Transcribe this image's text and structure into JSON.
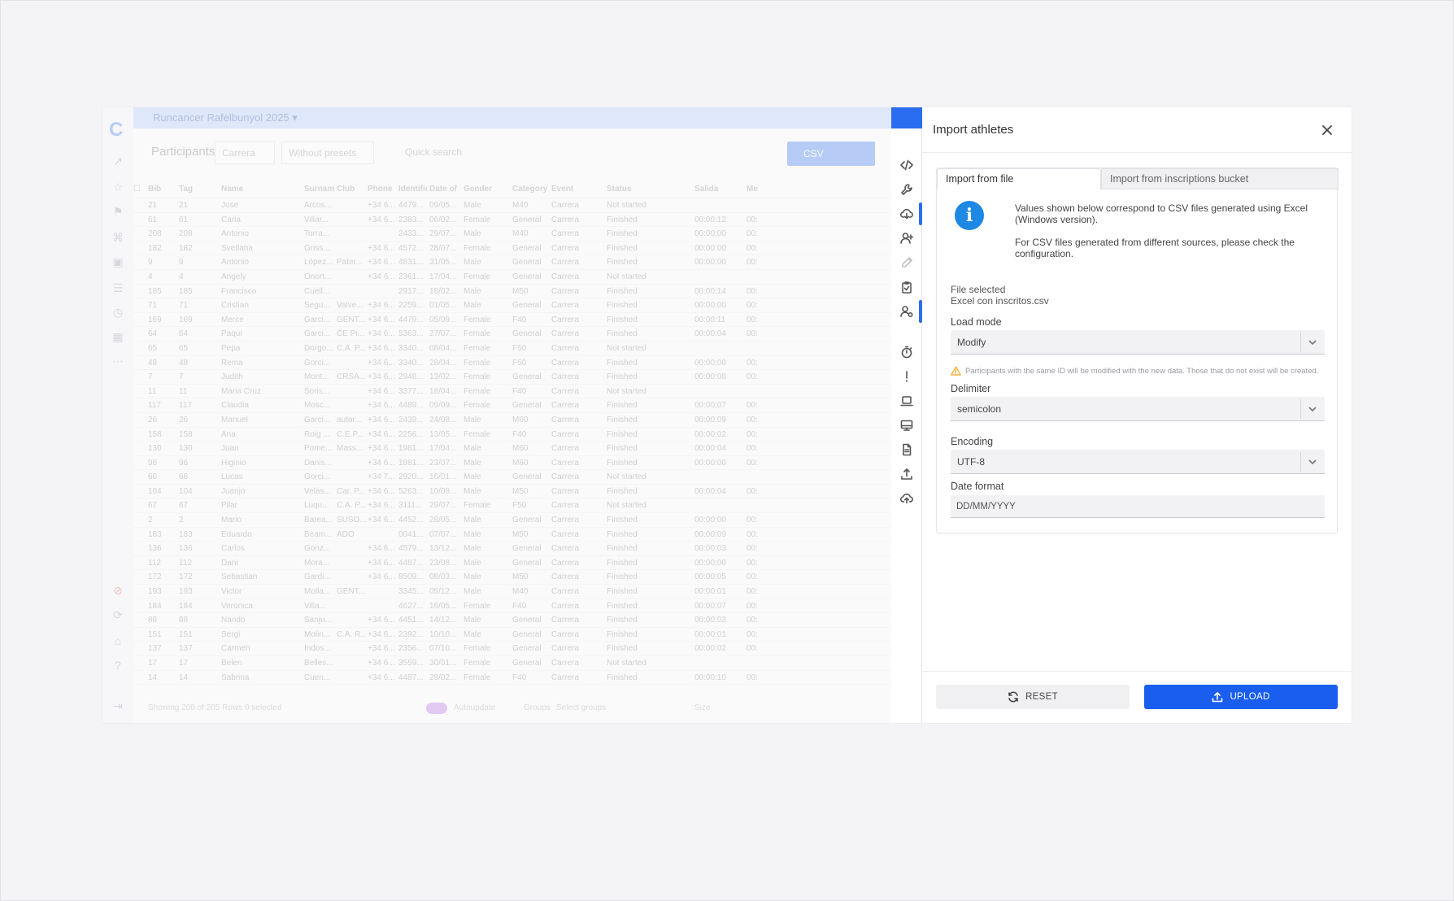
{
  "background_app": {
    "event_name": "Runcancer Rafelbunyol 2025",
    "toolbar": {
      "title": "Participants",
      "event_select": "Carrera",
      "preset_select": "Without presets",
      "search_placeholder": "Quick search",
      "csv_label": "CSV"
    },
    "table": {
      "columns": [
        "Bib",
        "Tag",
        "Name",
        "Surname",
        "Club",
        "Phone",
        "Identific",
        "Date of",
        "Gender",
        "Category",
        "Event",
        "Status",
        "Salida",
        "Me"
      ],
      "rows": [
        [
          "21",
          "21",
          "Jose",
          "Arcos...",
          "",
          "+34 6...",
          "4479...",
          "09/05...",
          "Male",
          "M40",
          "Carrera",
          "Not started",
          "",
          ""
        ],
        [
          "61",
          "61",
          "Carla",
          "Villar...",
          "",
          "+34 6...",
          "2383...",
          "06/02...",
          "Female",
          "General",
          "Carrera",
          "Finished",
          "00:00:12",
          "00:"
        ],
        [
          "208",
          "208",
          "Antonio",
          "Torra...",
          "",
          "",
          "2433...",
          "29/07...",
          "Male",
          "M40",
          "Carrera",
          "Finished",
          "00:00:00",
          "00:"
        ],
        [
          "182",
          "182",
          "Svetlana",
          "Griss...",
          "",
          "+34 6...",
          "4572...",
          "28/07...",
          "Female",
          "General",
          "Carrera",
          "Finished",
          "00:00:00",
          "00:"
        ],
        [
          "9",
          "9",
          "Antonio",
          "López...",
          "Pater...",
          "+34 6...",
          "4831...",
          "31/05...",
          "Male",
          "General",
          "Carrera",
          "Finished",
          "00:00:00",
          "00:"
        ],
        [
          "4",
          "4",
          "Angely",
          "Onort...",
          "",
          "+34 6...",
          "2361...",
          "17/04...",
          "Female",
          "General",
          "Carrera",
          "Not started",
          "",
          ""
        ],
        [
          "185",
          "185",
          "Francisco",
          "Cuell...",
          "",
          "",
          "2917...",
          "18/02...",
          "Male",
          "M50",
          "Carrera",
          "Finished",
          "00:00:14",
          "00:"
        ],
        [
          "71",
          "71",
          "Cristian",
          "Segu...",
          "Valve...",
          "+34 6...",
          "2259...",
          "01/05...",
          "Male",
          "General",
          "Carrera",
          "Finished",
          "00:00:00",
          "00:"
        ],
        [
          "169",
          "169",
          "Merce",
          "Garci...",
          "GENT...",
          "+34 6...",
          "4479...",
          "05/09...",
          "Female",
          "F40",
          "Carrera",
          "Finished",
          "00:00:11",
          "00:"
        ],
        [
          "64",
          "64",
          "Paqui",
          "Garci...",
          "CE Pi...",
          "+34 6...",
          "5363...",
          "27/07...",
          "Female",
          "General",
          "Carrera",
          "Finished",
          "00:00:04",
          "00:"
        ],
        [
          "65",
          "65",
          "Pepa",
          "Dorgo...",
          "C.A. P...",
          "+34 6...",
          "3340...",
          "08/04...",
          "Female",
          "F50",
          "Carrera",
          "Not started",
          "",
          ""
        ],
        [
          "48",
          "48",
          "Rema",
          "Gorci...",
          "",
          "+34 6...",
          "3340...",
          "28/04...",
          "Female",
          "F50",
          "Carrera",
          "Finished",
          "00:00:00",
          "00:"
        ],
        [
          "7",
          "7",
          "Judith",
          "Mont...",
          "CRSA...",
          "+34 6...",
          "2948...",
          "13/02...",
          "Female",
          "General",
          "Carrera",
          "Finished",
          "00:00:08",
          "00:"
        ],
        [
          "11",
          "11",
          "Maria Cruz",
          "Soris...",
          "",
          "+34 6...",
          "3377...",
          "18/04...",
          "Female",
          "F40",
          "Carrera",
          "Not started",
          "",
          ""
        ],
        [
          "117",
          "117",
          "Claudia",
          "Mosc...",
          "",
          "+34 6...",
          "4489...",
          "09/09...",
          "Female",
          "General",
          "Carrera",
          "Finished",
          "00:00:07",
          "00:"
        ],
        [
          "26",
          "26",
          "Manuel",
          "Garci...",
          "autor...",
          "+34 6...",
          "2439...",
          "24/08...",
          "Male",
          "M60",
          "Carrera",
          "Finished",
          "00:00:09",
          "00:"
        ],
        [
          "158",
          "158",
          "Ana",
          "Roig ...",
          "C.E.P...",
          "+34 6...",
          "2256...",
          "13/05...",
          "Female",
          "F40",
          "Carrera",
          "Finished",
          "00:00:02",
          "00:"
        ],
        [
          "130",
          "130",
          "Juan",
          "Pome...",
          "Mass...",
          "+34 6...",
          "1981...",
          "17/04...",
          "Male",
          "M60",
          "Carrera",
          "Finished",
          "00:00:04",
          "00:"
        ],
        [
          "96",
          "96",
          "Higinio",
          "Danis...",
          "",
          "+34 6...",
          "1881...",
          "23/07...",
          "Male",
          "M60",
          "Carrera",
          "Finished",
          "00:00:00",
          "00:"
        ],
        [
          "66",
          "66",
          "Lucas",
          "Gorci...",
          "",
          "+34 7...",
          "2920...",
          "16/01...",
          "Male",
          "General",
          "Carrera",
          "Not started",
          "",
          ""
        ],
        [
          "104",
          "104",
          "Juanjo",
          "Velas...",
          "Car. P...",
          "+34 6...",
          "5263...",
          "10/08...",
          "Male",
          "M50",
          "Carrera",
          "Finished",
          "00:00:04",
          "00:"
        ],
        [
          "67",
          "67",
          "Pilar",
          "Luqu...",
          "C.A. P...",
          "+34 6...",
          "3111...",
          "29/07...",
          "Female",
          "F50",
          "Carrera",
          "Not started",
          "",
          ""
        ],
        [
          "2",
          "2",
          "Mario",
          "Barea...",
          "SUSO...",
          "+34 6...",
          "4452...",
          "28/05...",
          "Male",
          "General",
          "Carrera",
          "Finished",
          "00:00:00",
          "00:"
        ],
        [
          "183",
          "183",
          "Eduardo",
          "Beam...",
          "ADO",
          "",
          "0041...",
          "07/07...",
          "Male",
          "M50",
          "Carrera",
          "Finished",
          "00:00:09",
          "00:"
        ],
        [
          "136",
          "136",
          "Carlos",
          "Gonz...",
          "",
          "+34 6...",
          "4579...",
          "13/12...",
          "Male",
          "General",
          "Carrera",
          "Finished",
          "00:00:03",
          "00:"
        ],
        [
          "112",
          "112",
          "Dani",
          "Mora...",
          "",
          "+34 6...",
          "4487...",
          "23/08...",
          "Male",
          "General",
          "Carrera",
          "Finished",
          "00:00:00",
          "00:"
        ],
        [
          "172",
          "172",
          "Sebastian",
          "Gardi...",
          "",
          "+34 6...",
          "8509...",
          "08/03...",
          "Male",
          "M50",
          "Carrera",
          "Finished",
          "00:00:05",
          "00:"
        ],
        [
          "193",
          "193",
          "Victor",
          "Molla...",
          "GENT...",
          "",
          "3345...",
          "05/12...",
          "Male",
          "M40",
          "Carrera",
          "Finished",
          "00:00:01",
          "00:"
        ],
        [
          "184",
          "184",
          "Veronica",
          "Villa...",
          "",
          "",
          "4627...",
          "16/05...",
          "Female",
          "F40",
          "Carrera",
          "Finished",
          "00:00:07",
          "00:"
        ],
        [
          "88",
          "88",
          "Nando",
          "Sanju...",
          "",
          "+34 6...",
          "4451...",
          "14/12...",
          "Male",
          "General",
          "Carrera",
          "Finished",
          "00:00:03",
          "00:"
        ],
        [
          "151",
          "151",
          "Sergi",
          "Molin...",
          "C.A. R...",
          "+34 6...",
          "2392...",
          "10/10...",
          "Male",
          "General",
          "Carrera",
          "Finished",
          "00:00:01",
          "00:"
        ],
        [
          "137",
          "137",
          "Carmen",
          "Indos...",
          "",
          "+34 6...",
          "2356...",
          "07/10...",
          "Female",
          "General",
          "Carrera",
          "Finished",
          "00:00:02",
          "00:"
        ],
        [
          "17",
          "17",
          "Belen",
          "Belles...",
          "",
          "+34 6...",
          "3559...",
          "30/01...",
          "Female",
          "General",
          "Carrera",
          "Not started",
          "",
          ""
        ],
        [
          "14",
          "14",
          "Sabrina",
          "Cuen...",
          "",
          "+34 6...",
          "4487...",
          "28/02...",
          "Female",
          "F40",
          "Carrera",
          "Finished",
          "00:00:10",
          "00:"
        ]
      ]
    },
    "footer": {
      "showing_text": "Showing 200 of 205 Rows 0 selected",
      "autoupdate_label": "Autoupdate",
      "groups_label": "Groups",
      "groups_placeholder": "Select groups",
      "size_value": "Size"
    }
  },
  "drawer": {
    "title": "Import athletes",
    "tabs": [
      {
        "label": "Import from file",
        "active": true
      },
      {
        "label": "Import from inscriptions bucket",
        "active": false
      }
    ],
    "info": {
      "line1": "Values shown below correspond to CSV files generated using Excel (Windows version).",
      "line2": "For CSV files generated from different sources, please check the configuration."
    },
    "file": {
      "label": "File selected",
      "name": "Excel con inscritos.csv"
    },
    "load_mode": {
      "label": "Load mode",
      "value": "Modify",
      "warning": "Participants with the same ID will be modified with the new data. Those that do not exist will be created."
    },
    "delimiter": {
      "label": "Delimiter",
      "value": "semicolon"
    },
    "encoding": {
      "label": "Encoding",
      "value": "UTF-8"
    },
    "date_format": {
      "label": "Date format",
      "value": "DD/MM/YYYY"
    },
    "buttons": {
      "reset": "RESET",
      "upload": "UPLOAD"
    }
  },
  "colors": {
    "primary": "#1a5ef0",
    "info": "#1e88e5",
    "warning": "#f5a623",
    "event_bar": "#a9c3f8"
  }
}
